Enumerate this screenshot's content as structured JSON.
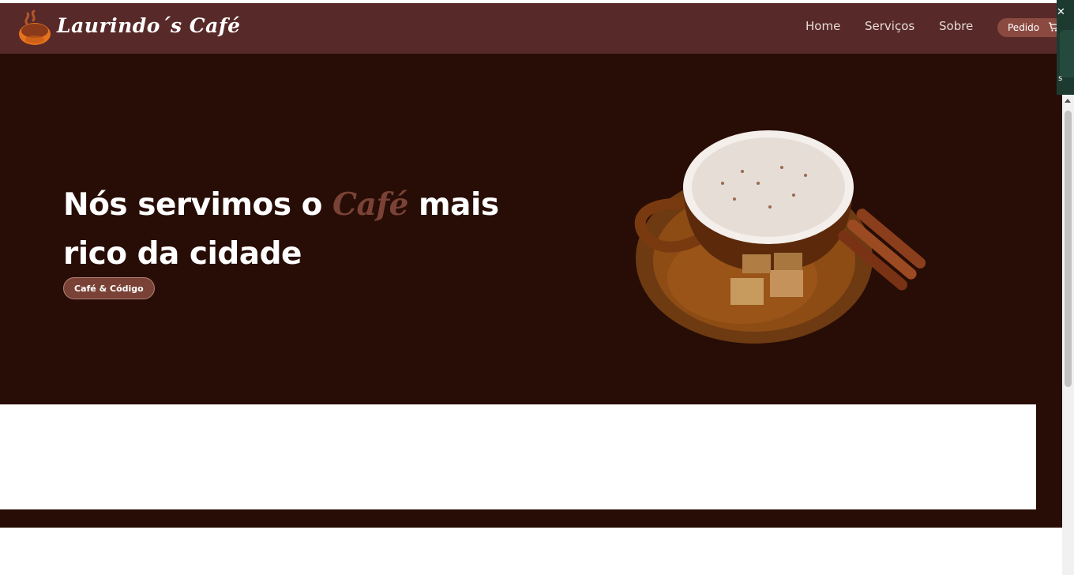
{
  "brand": {
    "name": "Laurindo´s Café",
    "logo_icon": "coffee-cup-logo-icon"
  },
  "nav": {
    "links": [
      {
        "label": "Home"
      },
      {
        "label": "Serviços"
      },
      {
        "label": "Sobre"
      }
    ],
    "order_button": {
      "label": "Pedido",
      "icon": "cart-icon"
    }
  },
  "hero": {
    "title_before": "Nós servimos o ",
    "title_accent": "Café",
    "title_after": " mais rico da cidade",
    "pill_label": "Café & Código",
    "image": "coffee-cup-with-cinnamon-and-sugar-cubes"
  },
  "colors": {
    "navbar_bg": "#572928",
    "hero_bg": "#270d05",
    "accent": "#7a4236",
    "button_bg": "#8a4a40"
  }
}
